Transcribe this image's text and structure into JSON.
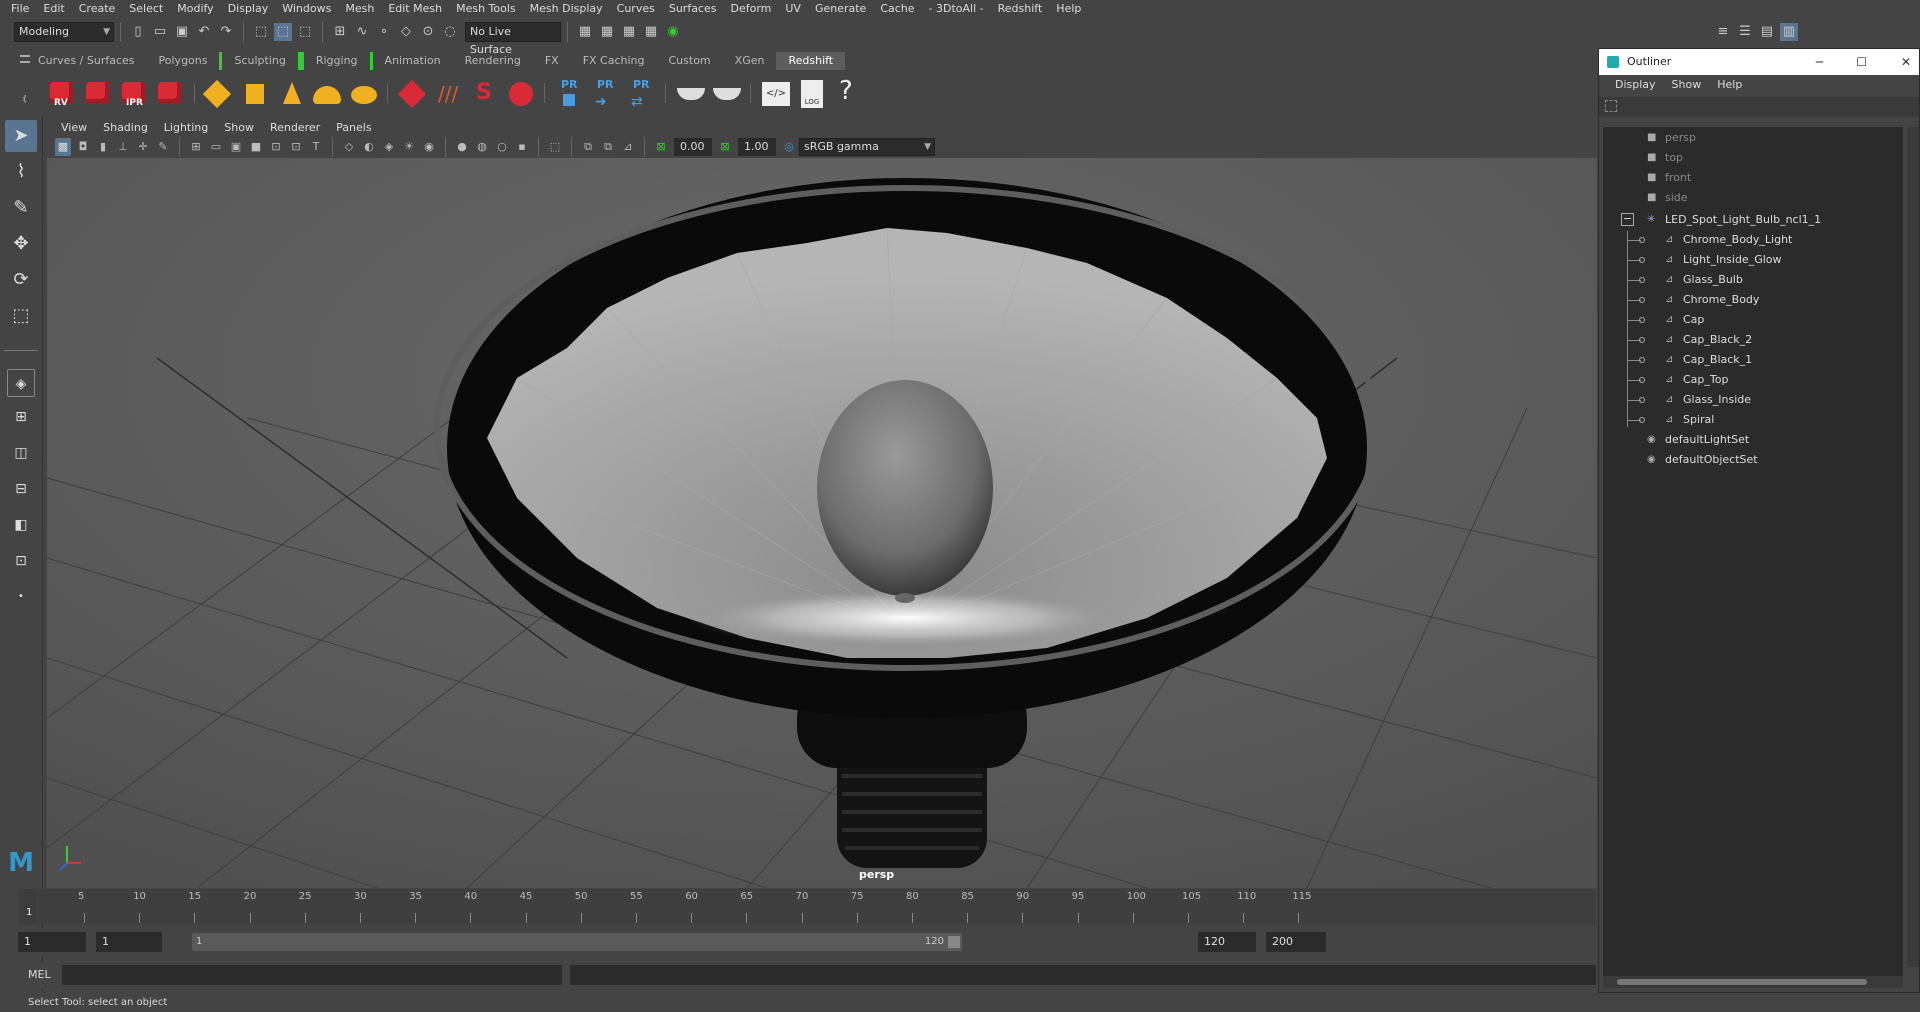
{
  "menubar": [
    "File",
    "Edit",
    "Create",
    "Select",
    "Modify",
    "Display",
    "Windows",
    "Mesh",
    "Edit Mesh",
    "Mesh Tools",
    "Mesh Display",
    "Curves",
    "Surfaces",
    "Deform",
    "UV",
    "Generate",
    "Cache",
    "- 3DtoAll -",
    "Redshift",
    "Help"
  ],
  "statusline": {
    "mode": "Modeling",
    "live_surface": "No Live Surface"
  },
  "shelf_tabs": [
    "Curves / Surfaces",
    "Polygons",
    "Sculpting",
    "Rigging",
    "Animation",
    "Rendering",
    "FX",
    "FX Caching",
    "Custom",
    "XGen",
    "Redshift"
  ],
  "shelf_active": "Redshift",
  "shelf_labels": {
    "rv": "RV",
    "ipr": "IPR",
    "pr1": "PR",
    "pr2": "PR",
    "pr3": "PR",
    "log": "LOG",
    "help": "?"
  },
  "panel_menu": [
    "View",
    "Shading",
    "Lighting",
    "Show",
    "Renderer",
    "Panels"
  ],
  "panel_toolbar": {
    "exposure": "0.00",
    "gamma": "1.00",
    "colorspace": "sRGB gamma"
  },
  "viewport": {
    "camera": "persp"
  },
  "timeline": {
    "ticks": [
      "5",
      "10",
      "15",
      "20",
      "25",
      "30",
      "35",
      "40",
      "45",
      "50",
      "55",
      "60",
      "65",
      "70",
      "75",
      "80",
      "85",
      "90",
      "95",
      "100",
      "105",
      "110",
      "115"
    ],
    "current": "1"
  },
  "range": {
    "start": "1",
    "playback_start": "1",
    "slider_start": "1",
    "slider_end": "120",
    "playback_end": "120",
    "end": "200"
  },
  "mel": {
    "label": "MEL"
  },
  "helpline": "Select Tool: select an object",
  "outliner": {
    "title": "Outliner",
    "menu": [
      "Display",
      "Show",
      "Help"
    ],
    "cameras": [
      "persp",
      "top",
      "front",
      "side"
    ],
    "group": "LED_Spot_Light_Bulb_ncl1_1",
    "children": [
      "Chrome_Body_Light",
      "Light_Inside_Glow",
      "Glass_Bulb",
      "Chrome_Body",
      "Cap",
      "Cap_Black_2",
      "Cap_Black_1",
      "Cap_Top",
      "Glass_Inside",
      "Spiral"
    ],
    "sets": [
      "defaultLightSet",
      "defaultObjectSet"
    ]
  }
}
